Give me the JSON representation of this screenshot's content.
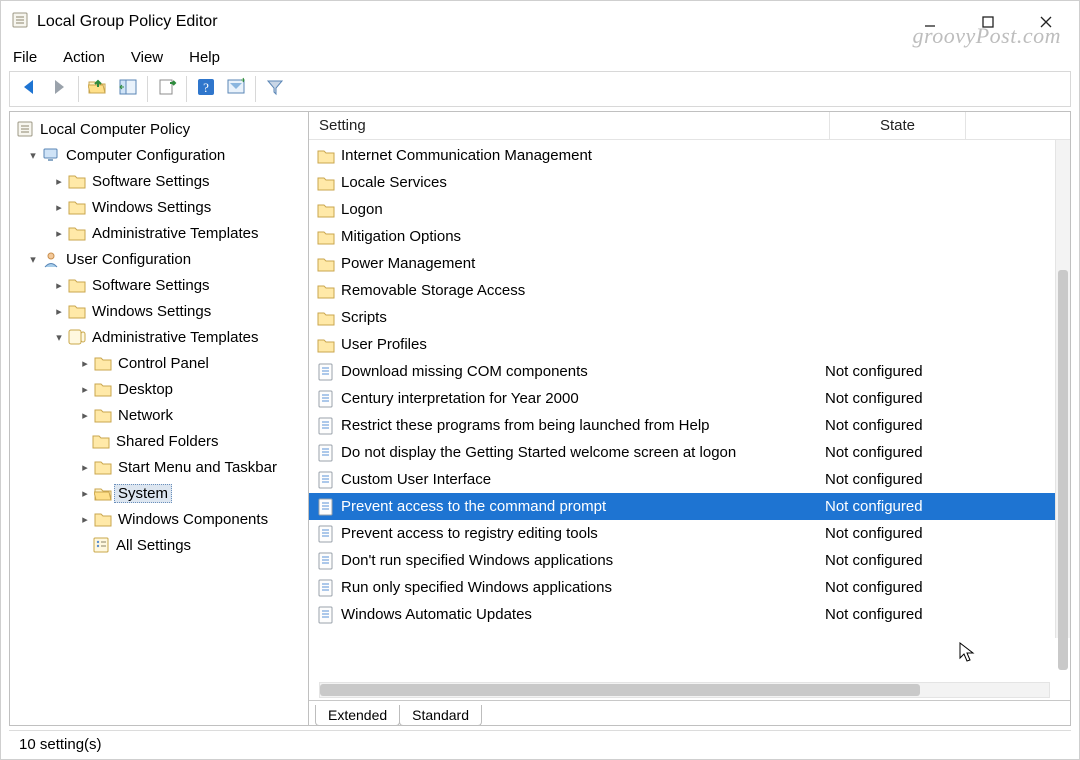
{
  "window": {
    "title": "Local Group Policy Editor"
  },
  "watermark": "groovyPost.com",
  "menubar": {
    "file": "File",
    "action": "Action",
    "view": "View",
    "help": "Help"
  },
  "toolbar_icons": {
    "back": "back-arrow-icon",
    "forward": "forward-arrow-icon",
    "up": "folder-up-icon",
    "show_hide": "show-hide-tree-icon",
    "export": "export-list-icon",
    "help": "help-icon",
    "filter_options": "filter-options-icon",
    "filter": "filter-funnel-icon"
  },
  "tree": {
    "root": {
      "label": "Local Computer Policy"
    },
    "computer_config": {
      "label": "Computer Configuration",
      "children": {
        "software": "Software Settings",
        "windows": "Windows Settings",
        "admin": "Administrative Templates"
      }
    },
    "user_config": {
      "label": "User Configuration",
      "children": {
        "software": "Software Settings",
        "windows": "Windows Settings",
        "admin": {
          "label": "Administrative Templates",
          "children": {
            "control_panel": "Control Panel",
            "desktop": "Desktop",
            "network": "Network",
            "shared_folders": "Shared Folders",
            "start_menu": "Start Menu and Taskbar",
            "system": "System",
            "windows_components": "Windows Components",
            "all_settings": "All Settings"
          }
        }
      }
    }
  },
  "columns": {
    "setting": "Setting",
    "state": "State"
  },
  "settings": {
    "folders": [
      {
        "name": "Internet Communication Management"
      },
      {
        "name": "Locale Services"
      },
      {
        "name": "Logon"
      },
      {
        "name": "Mitigation Options"
      },
      {
        "name": "Power Management"
      },
      {
        "name": "Removable Storage Access"
      },
      {
        "name": "Scripts"
      },
      {
        "name": "User Profiles"
      }
    ],
    "policies": [
      {
        "name": "Download missing COM components",
        "state": "Not configured"
      },
      {
        "name": "Century interpretation for Year 2000",
        "state": "Not configured"
      },
      {
        "name": "Restrict these programs from being launched from Help",
        "state": "Not configured"
      },
      {
        "name": "Do not display the Getting Started welcome screen at logon",
        "state": "Not configured"
      },
      {
        "name": "Custom User Interface",
        "state": "Not configured"
      },
      {
        "name": "Prevent access to the command prompt",
        "state": "Not configured",
        "selected": true
      },
      {
        "name": "Prevent access to registry editing tools",
        "state": "Not configured"
      },
      {
        "name": "Don't run specified Windows applications",
        "state": "Not configured"
      },
      {
        "name": "Run only specified Windows applications",
        "state": "Not configured"
      },
      {
        "name": "Windows Automatic Updates",
        "state": "Not configured"
      }
    ]
  },
  "tabs": {
    "extended": "Extended",
    "standard": "Standard"
  },
  "statusbar": "10 setting(s)"
}
